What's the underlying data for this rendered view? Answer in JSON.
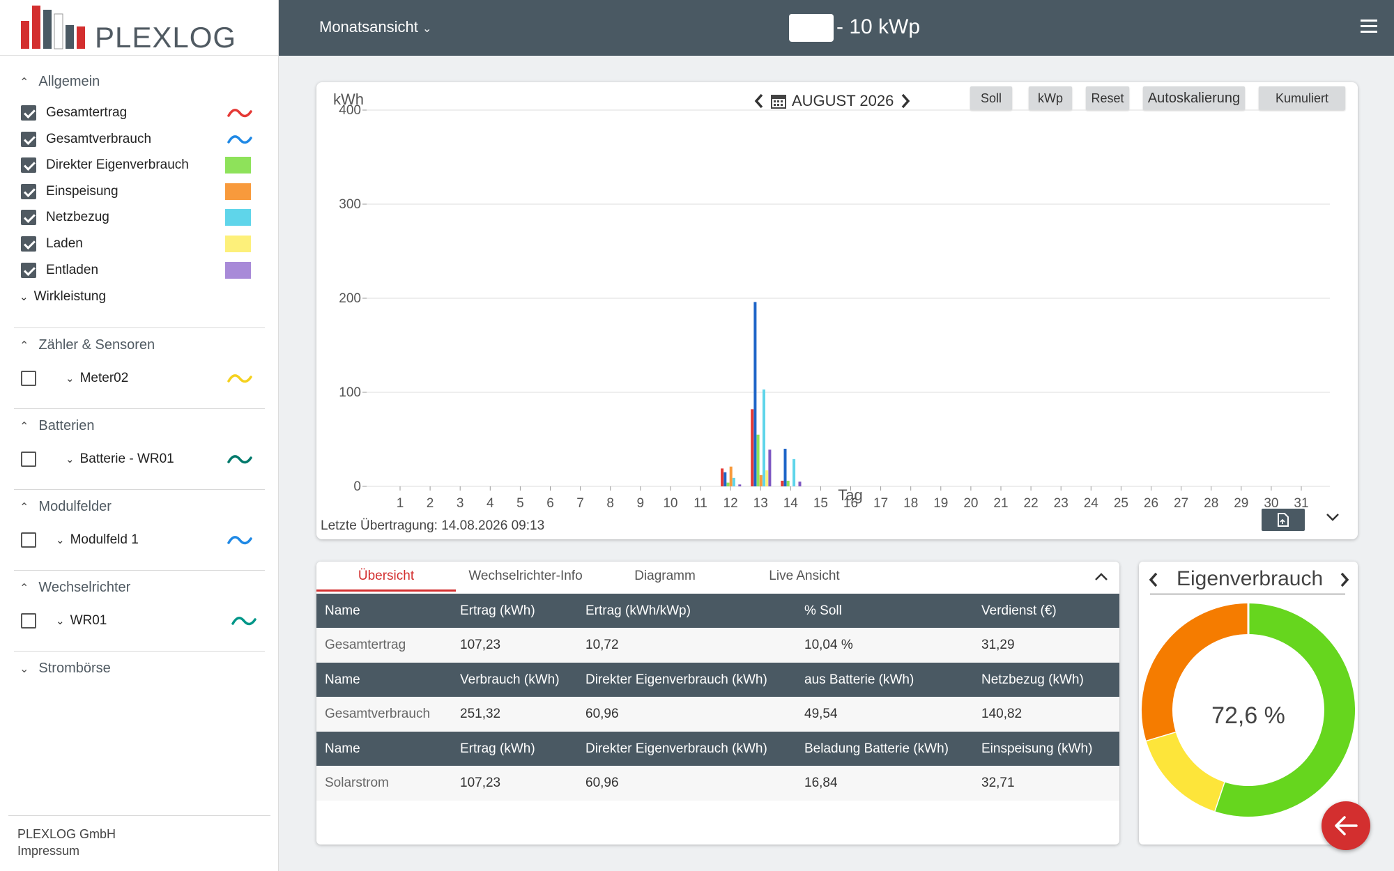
{
  "brand": {
    "name": "PLEXLOG"
  },
  "header": {
    "view_select": "Monatsansicht",
    "plant_title": "- 10 kWp"
  },
  "sidebar": {
    "sections": {
      "allgemein": {
        "title": "Allgemein"
      },
      "zaehler": {
        "title": "Zähler & Sensoren"
      },
      "batterien": {
        "title": "Batterien"
      },
      "modulfelder": {
        "title": "Modulfelder"
      },
      "wechselrichter": {
        "title": "Wechselrichter"
      },
      "stromboerse": {
        "title": "Strombörse"
      }
    },
    "allgemein_items": [
      {
        "label": "Gesamtertrag",
        "color": "#e53935"
      },
      {
        "label": "Gesamtverbrauch",
        "color": "#1e88e5"
      },
      {
        "label": "Direkter Eigenverbrauch",
        "color": "#8ee25a"
      },
      {
        "label": "Einspeisung",
        "color": "#f89a3c"
      },
      {
        "label": "Netzbezug",
        "color": "#5fd5ea"
      },
      {
        "label": "Laden",
        "color": "#fdf07a"
      },
      {
        "label": "Entladen",
        "color": "#a88ad8"
      }
    ],
    "wirkleistung": "Wirkleistung",
    "meter": {
      "label": "Meter02",
      "color": "#f5d11d"
    },
    "battery": {
      "label": "Batterie - WR01",
      "color": "#00796b"
    },
    "modulfeld": {
      "label": "Modulfeld 1",
      "color": "#1e88e5"
    },
    "inverter": {
      "label": "WR01",
      "color": "#009688"
    },
    "footer": {
      "company": "PLEXLOG GmbH",
      "impressum": "Impressum"
    }
  },
  "chart_toolbar": {
    "month": "AUGUST 2026",
    "buttons": [
      "Soll",
      "kWp",
      "Reset",
      "Autoskalierung",
      "Kumuliert"
    ]
  },
  "chart_data": {
    "type": "bar",
    "ylabel": "kWh",
    "xlabel": "Tag",
    "ylim": [
      0,
      400
    ],
    "yticks": [
      0,
      100,
      200,
      300,
      400
    ],
    "categories": [
      "1",
      "2",
      "3",
      "4",
      "5",
      "6",
      "7",
      "8",
      "9",
      "10",
      "11",
      "12",
      "13",
      "14",
      "15",
      "16",
      "17",
      "18",
      "19",
      "20",
      "21",
      "22",
      "23",
      "24",
      "25",
      "26",
      "27",
      "28",
      "29",
      "30",
      "31"
    ],
    "series": [
      {
        "name": "Gesamtertrag",
        "color": "#e53935",
        "values": [
          0,
          0,
          0,
          0,
          0,
          0,
          0,
          0,
          0,
          0,
          0,
          19,
          82,
          6,
          0,
          0,
          0,
          0,
          0,
          0,
          0,
          0,
          0,
          0,
          0,
          0,
          0,
          0,
          0,
          0,
          0
        ]
      },
      {
        "name": "Gesamtverbrauch",
        "color": "#1e65c8",
        "values": [
          0,
          0,
          0,
          0,
          0,
          0,
          0,
          0,
          0,
          0,
          0,
          15,
          196,
          40,
          0,
          0,
          0,
          0,
          0,
          0,
          0,
          0,
          0,
          0,
          0,
          0,
          0,
          0,
          0,
          0,
          0
        ]
      },
      {
        "name": "Direkter Eigenverbrauch",
        "color": "#8ee25a",
        "values": [
          0,
          0,
          0,
          0,
          0,
          0,
          0,
          0,
          0,
          0,
          0,
          4,
          55,
          6,
          0,
          0,
          0,
          0,
          0,
          0,
          0,
          0,
          0,
          0,
          0,
          0,
          0,
          0,
          0,
          0,
          0
        ]
      },
      {
        "name": "Einspeisung",
        "color": "#f89a3c",
        "values": [
          0,
          0,
          0,
          0,
          0,
          0,
          0,
          0,
          0,
          0,
          0,
          21,
          12,
          0,
          0,
          0,
          0,
          0,
          0,
          0,
          0,
          0,
          0,
          0,
          0,
          0,
          0,
          0,
          0,
          0,
          0
        ]
      },
      {
        "name": "Netzbezug",
        "color": "#5fd5ea",
        "values": [
          0,
          0,
          0,
          0,
          0,
          0,
          0,
          0,
          0,
          0,
          0,
          9,
          103,
          29,
          0,
          0,
          0,
          0,
          0,
          0,
          0,
          0,
          0,
          0,
          0,
          0,
          0,
          0,
          0,
          0,
          0
        ]
      },
      {
        "name": "Laden",
        "color": "#fdf07a",
        "values": [
          0,
          0,
          0,
          0,
          0,
          0,
          0,
          0,
          0,
          0,
          0,
          0,
          17,
          0,
          0,
          0,
          0,
          0,
          0,
          0,
          0,
          0,
          0,
          0,
          0,
          0,
          0,
          0,
          0,
          0,
          0
        ]
      },
      {
        "name": "Entladen",
        "color": "#7e57c2",
        "values": [
          0,
          0,
          0,
          0,
          0,
          0,
          0,
          0,
          0,
          0,
          0,
          2,
          39,
          5,
          0,
          0,
          0,
          0,
          0,
          0,
          0,
          0,
          0,
          0,
          0,
          0,
          0,
          0,
          0,
          0,
          0
        ]
      }
    ]
  },
  "last_transfer": "Letzte Übertragung: 14.08.2026 09:13",
  "tabs": [
    "Übersicht",
    "Wechselrichter-Info",
    "Diagramm",
    "Live Ansicht"
  ],
  "table": {
    "groups": [
      {
        "headers": [
          "Name",
          "Ertrag (kWh)",
          "Ertrag (kWh/kWp)",
          "% Soll",
          "Verdienst (€)"
        ],
        "row": [
          "Gesamtertrag",
          "107,23",
          "10,72",
          "10,04 %",
          "31,29"
        ]
      },
      {
        "headers": [
          "Name",
          "Verbrauch (kWh)",
          "Direkter Eigenverbrauch (kWh)",
          "aus Batterie (kWh)",
          "Netzbezug (kWh)"
        ],
        "row": [
          "Gesamtverbrauch",
          "251,32",
          "60,96",
          "49,54",
          "140,82"
        ]
      },
      {
        "headers": [
          "Name",
          "Ertrag (kWh)",
          "Direkter Eigenverbrauch (kWh)",
          "Beladung Batterie (kWh)",
          "Einspeisung (kWh)"
        ],
        "row": [
          "Solarstrom",
          "107,23",
          "60,96",
          "16,84",
          "32,71"
        ]
      }
    ]
  },
  "donut": {
    "title": "Eigenverbrauch",
    "value_text": "72,6 %",
    "segments": [
      {
        "value": 60.96,
        "color": "#66d61e"
      },
      {
        "value": 16.84,
        "color": "#fde53a"
      },
      {
        "value": 32.71,
        "color": "#f57c00"
      }
    ]
  }
}
